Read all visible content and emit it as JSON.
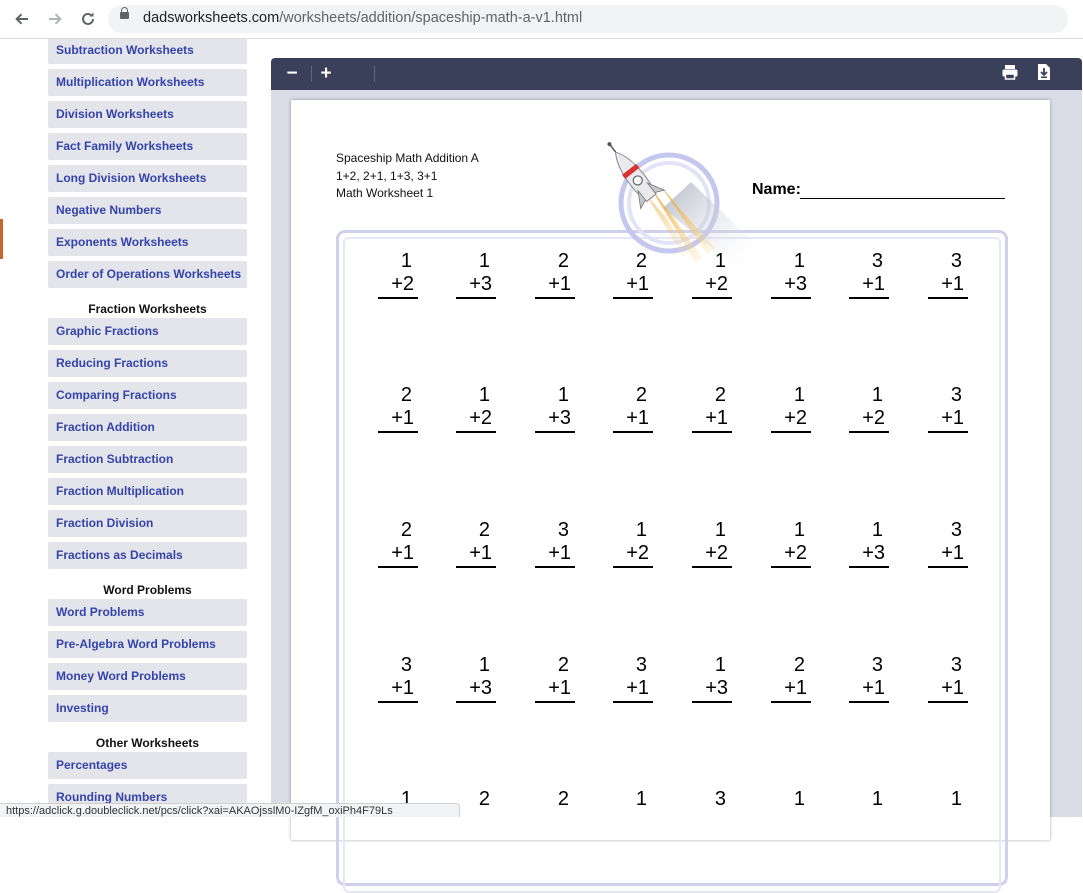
{
  "browser": {
    "url_host": "dadsworksheets.com",
    "url_path": "/worksheets/addition/spaceship-math-a-v1.html",
    "back_icon": "arrow-left-icon",
    "forward_icon": "arrow-right-icon",
    "reload_icon": "reload-icon"
  },
  "sidebar": {
    "items": [
      {
        "label": "Subtraction Worksheets"
      },
      {
        "label": "Multiplication Worksheets"
      },
      {
        "label": "Division Worksheets"
      },
      {
        "label": "Fact Family Worksheets"
      },
      {
        "label": "Long Division Worksheets"
      },
      {
        "label": "Negative Numbers"
      },
      {
        "label": "Exponents Worksheets"
      },
      {
        "label": "Order of Operations Worksheets"
      },
      {
        "heading": "Fraction Worksheets"
      },
      {
        "label": "Graphic Fractions"
      },
      {
        "label": "Reducing Fractions"
      },
      {
        "label": "Comparing Fractions"
      },
      {
        "label": "Fraction Addition"
      },
      {
        "label": "Fraction Subtraction"
      },
      {
        "label": "Fraction Multiplication"
      },
      {
        "label": "Fraction Division"
      },
      {
        "label": "Fractions as Decimals"
      },
      {
        "heading": "Word Problems"
      },
      {
        "label": "Word Problems"
      },
      {
        "label": "Pre-Algebra Word Problems"
      },
      {
        "label": "Money Word Problems"
      },
      {
        "label": "Investing"
      },
      {
        "heading": "Other Worksheets"
      },
      {
        "label": "Percentages"
      },
      {
        "label": "Rounding Numbers"
      }
    ]
  },
  "viewer": {
    "zoom_out": "−",
    "zoom_in": "+",
    "print_icon": "print-icon",
    "download_icon": "download-icon"
  },
  "worksheet": {
    "title_line1": "Spaceship Math Addition A",
    "title_line2": "1+2, 2+1, 1+3, 3+1",
    "title_line3": "Math Worksheet 1",
    "name_label": "Name:",
    "problems": [
      [
        {
          "top": "1",
          "bottom": "+2"
        },
        {
          "top": "1",
          "bottom": "+3"
        },
        {
          "top": "2",
          "bottom": "+1"
        },
        {
          "top": "2",
          "bottom": "+1"
        },
        {
          "top": "1",
          "bottom": "+2"
        },
        {
          "top": "1",
          "bottom": "+3"
        },
        {
          "top": "3",
          "bottom": "+1"
        },
        {
          "top": "3",
          "bottom": "+1"
        }
      ],
      [
        {
          "top": "2",
          "bottom": "+1"
        },
        {
          "top": "1",
          "bottom": "+2"
        },
        {
          "top": "1",
          "bottom": "+3"
        },
        {
          "top": "2",
          "bottom": "+1"
        },
        {
          "top": "2",
          "bottom": "+1"
        },
        {
          "top": "1",
          "bottom": "+2"
        },
        {
          "top": "1",
          "bottom": "+2"
        },
        {
          "top": "3",
          "bottom": "+1"
        }
      ],
      [
        {
          "top": "2",
          "bottom": "+1"
        },
        {
          "top": "2",
          "bottom": "+1"
        },
        {
          "top": "3",
          "bottom": "+1"
        },
        {
          "top": "1",
          "bottom": "+2"
        },
        {
          "top": "1",
          "bottom": "+2"
        },
        {
          "top": "1",
          "bottom": "+2"
        },
        {
          "top": "1",
          "bottom": "+3"
        },
        {
          "top": "3",
          "bottom": "+1"
        }
      ],
      [
        {
          "top": "3",
          "bottom": "+1"
        },
        {
          "top": "1",
          "bottom": "+3"
        },
        {
          "top": "2",
          "bottom": "+1"
        },
        {
          "top": "3",
          "bottom": "+1"
        },
        {
          "top": "1",
          "bottom": "+3"
        },
        {
          "top": "2",
          "bottom": "+1"
        },
        {
          "top": "3",
          "bottom": "+1"
        },
        {
          "top": "3",
          "bottom": "+1"
        }
      ],
      [
        {
          "top": "1",
          "bottom": ""
        },
        {
          "top": "2",
          "bottom": ""
        },
        {
          "top": "2",
          "bottom": ""
        },
        {
          "top": "1",
          "bottom": ""
        },
        {
          "top": "3",
          "bottom": ""
        },
        {
          "top": "1",
          "bottom": ""
        },
        {
          "top": "1",
          "bottom": ""
        },
        {
          "top": "1",
          "bottom": ""
        }
      ]
    ]
  },
  "status_bar": {
    "text": "https://adclick.g.doubleclick.net/pcs/click?xai=AKAOjsslM0-IZgfM_oxiPh4F79Ls"
  }
}
